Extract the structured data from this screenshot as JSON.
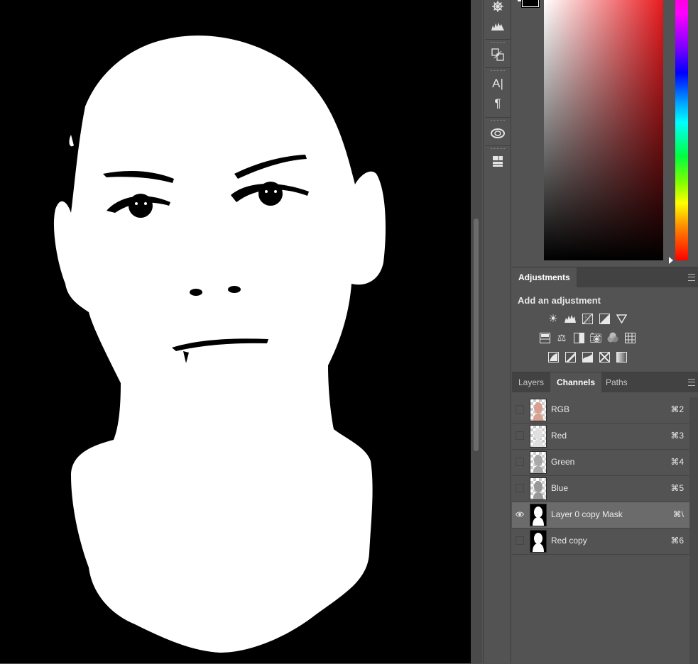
{
  "canvas": {
    "description_icon": "portrait-mask-image"
  },
  "strip_icons": [
    "helm-icon",
    "histogram-icon",
    "transform-icon",
    "character-icon",
    "paragraph-icon",
    "creative-cloud-icon",
    "library-icon"
  ],
  "colors": {
    "hue_selected": "#e81b1f",
    "panel_bg": "#535353",
    "tab_bar": "#424242",
    "canvas_bg": "#000000"
  },
  "adjustments": {
    "tab_label": "Adjustments",
    "title": "Add an adjustment",
    "icons": [
      [
        "brightness-contrast-icon",
        "levels-icon",
        "curves-icon",
        "exposure-icon",
        "vibrance-icon"
      ],
      [
        "hue-saturation-icon",
        "color-balance-icon",
        "black-white-icon",
        "photo-filter-icon",
        "channel-mixer-icon",
        "color-lookup-icon"
      ],
      [
        "invert-icon",
        "posterize-icon",
        "threshold-icon",
        "selective-color-icon",
        "gradient-map-icon"
      ]
    ]
  },
  "tabs": [
    {
      "label": "Layers",
      "active": false
    },
    {
      "label": "Channels",
      "active": true
    },
    {
      "label": "Paths",
      "active": false
    }
  ],
  "channels": [
    {
      "name": "RGB",
      "key": "⌘2",
      "visible": false,
      "selected": false,
      "thumb": "checker"
    },
    {
      "name": "Red",
      "key": "⌘3",
      "visible": false,
      "selected": false,
      "thumb": "checker"
    },
    {
      "name": "Green",
      "key": "⌘4",
      "visible": false,
      "selected": false,
      "thumb": "checker"
    },
    {
      "name": "Blue",
      "key": "⌘5",
      "visible": false,
      "selected": false,
      "thumb": "checker"
    },
    {
      "name": "Layer 0 copy Mask",
      "key": "⌘\\",
      "visible": true,
      "selected": true,
      "thumb": "mask"
    },
    {
      "name": "Red copy",
      "key": "⌘6",
      "visible": false,
      "selected": false,
      "thumb": "mask"
    }
  ]
}
